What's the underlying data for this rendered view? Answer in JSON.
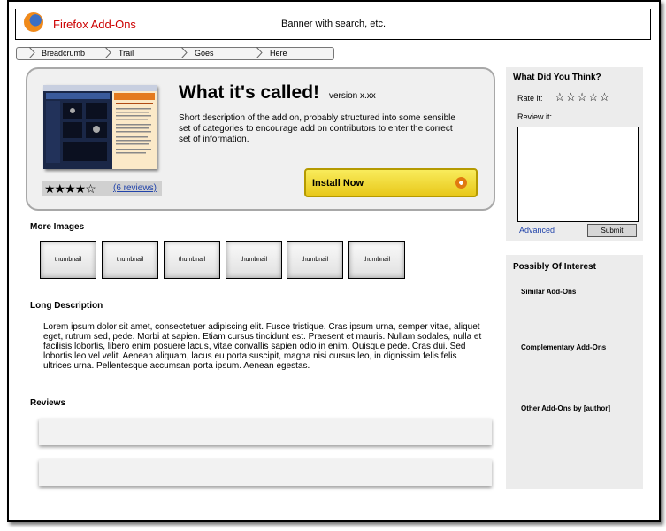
{
  "header": {
    "brand": "Firefox Add-Ons",
    "banner": "Banner with search, etc."
  },
  "breadcrumb": [
    "Breadcrumb",
    "Trail",
    "Goes",
    "Here"
  ],
  "addon": {
    "title": "What it's called!",
    "version": "version x.xx",
    "short_description": "Short description of the add on, probably structured into some sensible set of categories to encourage add on contributors to enter the correct set of information.",
    "rating_stars": "★★★★☆",
    "rating": 4,
    "reviews_link": "(6 reviews)",
    "install_label": "Install Now"
  },
  "more_images": {
    "heading": "More Images",
    "thumbs": [
      "thumbnail",
      "thumbnail",
      "thumbnail",
      "thumbnail",
      "thumbnail",
      "thumbnail"
    ]
  },
  "long_description": {
    "heading": "Long Description",
    "text": "Lorem ipsum dolor sit amet, consectetuer adipiscing elit. Fusce tristique. Cras ipsum urna, semper vitae, aliquet eget, rutrum sed, pede. Morbi at sapien. Etiam cursus tincidunt est. Praesent et mauris. Nullam sodales, nulla et facilisis lobortis, libero enim posuere lacus, vitae convallis sapien odio in enim. Quisque pede. Cras dui. Sed lobortis leo vel velit. Aenean aliquam, lacus eu porta suscipit, magna nisi cursus leo, in dignissim felis felis ultrices urna. Pellentesque accumsan porta ipsum. Aenean egestas."
  },
  "reviews": {
    "heading": "Reviews"
  },
  "feedback": {
    "heading": "What Did You Think?",
    "rate_label": "Rate it:",
    "rate_stars": "☆☆☆☆☆",
    "review_label": "Review it:",
    "advanced_link": "Advanced",
    "submit_label": "Submit"
  },
  "interest": {
    "heading": "Possibly Of Interest",
    "similar": "Similar Add-Ons",
    "complementary": "Complementary Add-Ons",
    "other": "Other Add-Ons by [author]"
  }
}
